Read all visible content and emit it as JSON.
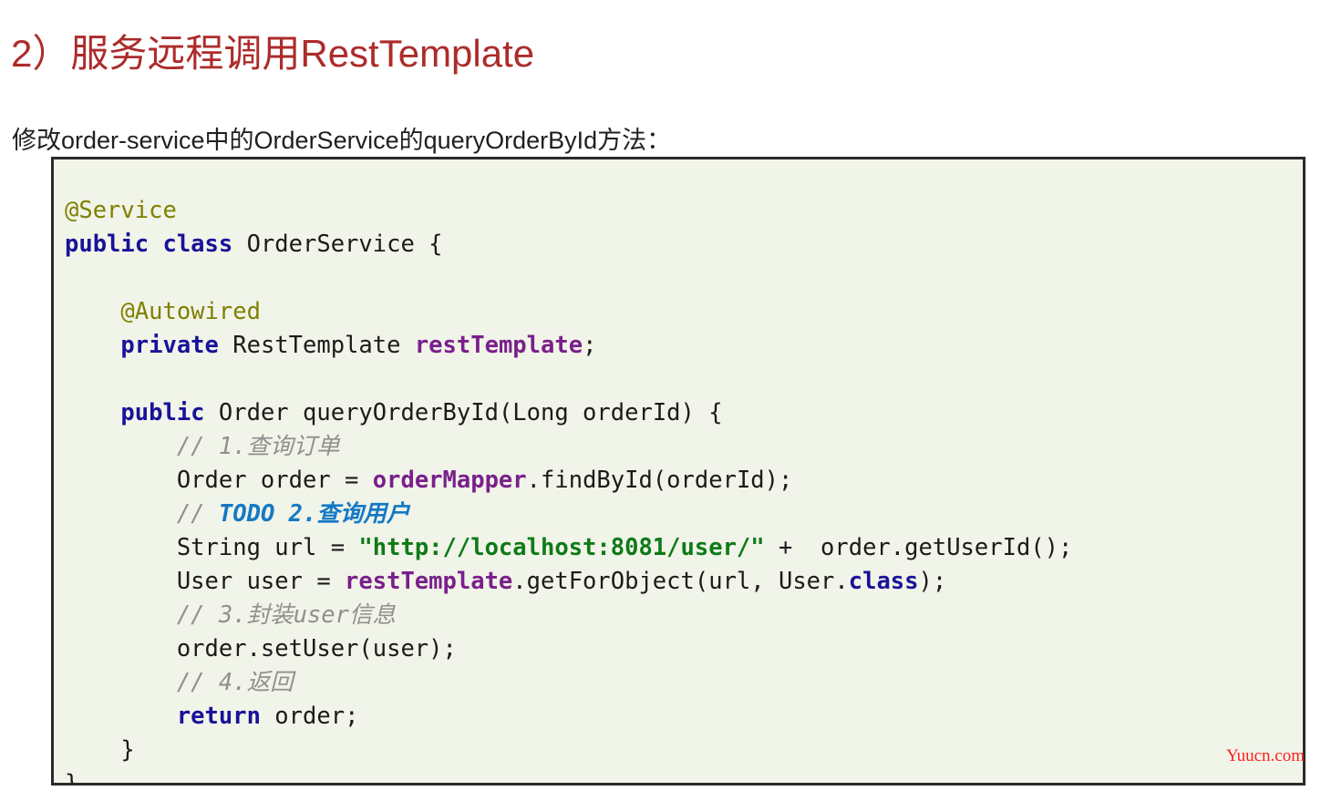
{
  "document": {
    "title": "2）服务远程调用RestTemplate",
    "subtitle": "修改order-service中的OrderService的queryOrderById方法：",
    "watermark": "Yuucn.com",
    "colors": {
      "title": "#ad2b2b",
      "body_text": "#1f1f1f",
      "code_background": "#f1f4e8",
      "code_border": "#2b2b2b",
      "annotation": "#808000",
      "keyword": "#181299",
      "field": "#7a1f8c",
      "string": "#0f7a18",
      "comment": "#909090",
      "todo": "#1479c4",
      "watermark": "#ff2020"
    }
  },
  "code": {
    "language": "java",
    "lines": [
      {
        "tokens": [
          {
            "t": "@Service",
            "c": "anno"
          }
        ]
      },
      {
        "tokens": [
          {
            "t": "public class",
            "c": "kw"
          },
          {
            "t": " OrderService {",
            "c": "plain"
          }
        ]
      },
      {
        "tokens": []
      },
      {
        "tokens": [
          {
            "t": "    @Autowired",
            "c": "anno"
          }
        ]
      },
      {
        "tokens": [
          {
            "t": "    ",
            "c": "plain"
          },
          {
            "t": "private",
            "c": "kw"
          },
          {
            "t": " RestTemplate ",
            "c": "plain"
          },
          {
            "t": "restTemplate",
            "c": "field"
          },
          {
            "t": ";",
            "c": "plain"
          }
        ]
      },
      {
        "tokens": []
      },
      {
        "tokens": [
          {
            "t": "    ",
            "c": "plain"
          },
          {
            "t": "public",
            "c": "kw"
          },
          {
            "t": " Order queryOrderById(Long orderId) {",
            "c": "plain"
          }
        ]
      },
      {
        "tokens": [
          {
            "t": "        // 1.查询订单",
            "c": "comment"
          }
        ]
      },
      {
        "tokens": [
          {
            "t": "        Order order = ",
            "c": "plain"
          },
          {
            "t": "orderMapper",
            "c": "field"
          },
          {
            "t": ".findById(orderId);",
            "c": "plain"
          }
        ]
      },
      {
        "tokens": [
          {
            "t": "        // ",
            "c": "comment"
          },
          {
            "t": "TODO 2.查询用户",
            "c": "todo"
          }
        ]
      },
      {
        "tokens": [
          {
            "t": "        String url = ",
            "c": "plain"
          },
          {
            "t": "\"http://localhost:8081/user/\"",
            "c": "str"
          },
          {
            "t": " +  order.getUserId();",
            "c": "plain"
          }
        ]
      },
      {
        "tokens": [
          {
            "t": "        User user = ",
            "c": "plain"
          },
          {
            "t": "restTemplate",
            "c": "field"
          },
          {
            "t": ".getForObject(url, User.",
            "c": "plain"
          },
          {
            "t": "class",
            "c": "kw"
          },
          {
            "t": ");",
            "c": "plain"
          }
        ]
      },
      {
        "tokens": [
          {
            "t": "        // 3.封装user信息",
            "c": "comment"
          }
        ]
      },
      {
        "tokens": [
          {
            "t": "        order.setUser(user);",
            "c": "plain"
          }
        ]
      },
      {
        "tokens": [
          {
            "t": "        // 4.返回",
            "c": "comment"
          }
        ]
      },
      {
        "tokens": [
          {
            "t": "        ",
            "c": "plain"
          },
          {
            "t": "return",
            "c": "kw"
          },
          {
            "t": " order;",
            "c": "plain"
          }
        ]
      },
      {
        "tokens": [
          {
            "t": "    }",
            "c": "plain"
          }
        ]
      },
      {
        "tokens": [
          {
            "t": "}",
            "c": "plain"
          }
        ]
      }
    ]
  }
}
